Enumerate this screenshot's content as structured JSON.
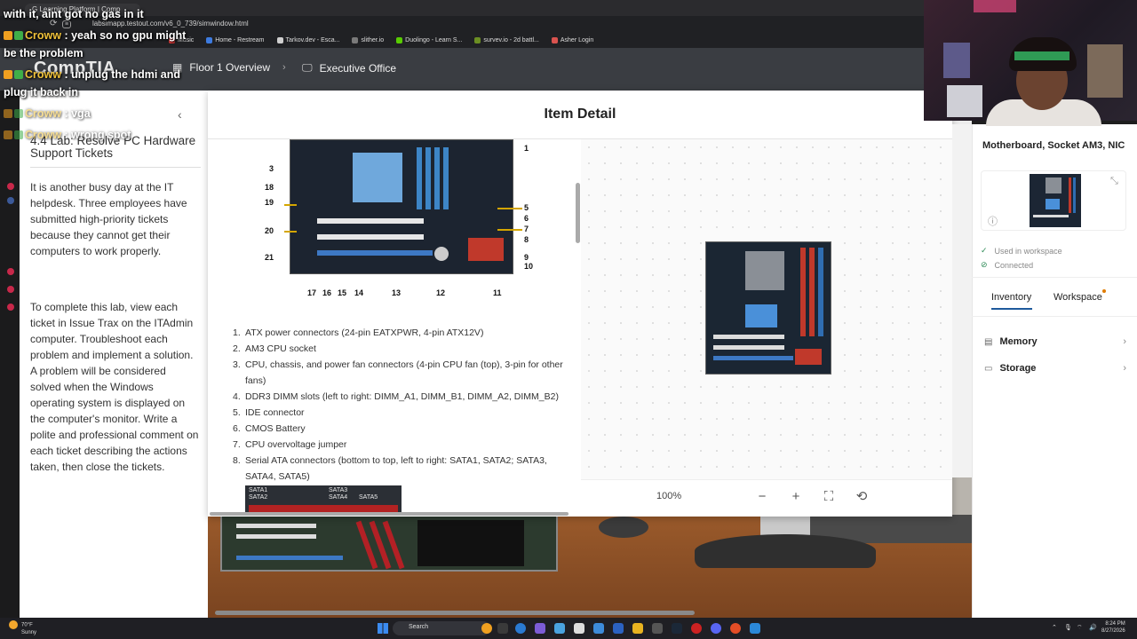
{
  "browser": {
    "tab_title": "G Learning Platform | Comp",
    "address": "labsimapp.testout.com/v6_0_739/simwindow.html",
    "bookmarks": [
      {
        "label": "Music",
        "color": "#e03a3a"
      },
      {
        "label": "Home - Restream",
        "color": "#3d7be0"
      },
      {
        "label": "Tarkov.dev - Esca...",
        "color": "#cfcfcf"
      },
      {
        "label": "slither.io",
        "color": "#7a7a7a"
      },
      {
        "label": "Duolingo - Learn S...",
        "color": "#58cc02"
      },
      {
        "label": "survev.io - 2d battl...",
        "color": "#6b8e23"
      },
      {
        "label": "Asher Login",
        "color": "#d9534f"
      }
    ]
  },
  "header": {
    "logo": "CompTIA",
    "crumbs": [
      {
        "label": "Floor 1 Overview",
        "icon": "floor-plan-icon"
      },
      {
        "label": "Executive Office",
        "icon": "monitor-icon"
      }
    ],
    "separator": "›"
  },
  "lab": {
    "title": "4.4 Lab: Resolve PC Hardware Support Tickets",
    "paragraph1": "It is another busy day at the IT helpdesk. Three employees have submitted high-priority tickets because they cannot get their computers to work properly.",
    "paragraph2": "To complete this lab, view each ticket in Issue Trax on the ITAdmin computer. Troubleshoot each problem and implement a solution. A problem will be considered solved when the Windows operating system is displayed on the computer's monitor. Write a polite and professional comment on each ticket describing the actions taken, then close the tickets.",
    "collapse_icon": "‹"
  },
  "modal": {
    "title": "Item Detail",
    "callouts": [
      "1",
      "3",
      "18",
      "19",
      "20",
      "21",
      "5",
      "6",
      "7",
      "8",
      "9",
      "10",
      "17",
      "16",
      "15",
      "14",
      "13",
      "12",
      "11"
    ],
    "components": [
      "ATX power connectors (24-pin EATXPWR, 4-pin ATX12V)",
      "AM3 CPU socket",
      "CPU, chassis, and power fan connectors (4-pin CPU fan (top), 3-pin for other fans)",
      "DDR3 DIMM slots (left to right: DIMM_A1, DIMM_B1, DIMM_A2, DIMM_B2)",
      "IDE connector",
      "CMOS Battery",
      "CPU overvoltage jumper",
      "Serial ATA connectors (bottom to top, left to right: SATA1, SATA2; SATA3, SATA4, SATA5)"
    ],
    "sata_labels": [
      "SATA1",
      "SATA2",
      "SATA3",
      "SATA4",
      "SATA5"
    ],
    "zoom": "100%",
    "controls": {
      "zoom_out": "−",
      "zoom_in": "+",
      "fit": "⛶",
      "rotate": "⟲"
    }
  },
  "sidebar": {
    "item_title": "Motherboard, Socket AM3, NIC",
    "info_icon": "ⓘ",
    "collapse_icon": "⤡",
    "status": [
      {
        "label": "Used in workspace",
        "icon": "✓"
      },
      {
        "label": "Connected",
        "icon": "⊘"
      }
    ],
    "tabs": [
      {
        "label": "Inventory",
        "active": true
      },
      {
        "label": "Workspace",
        "active": false
      }
    ],
    "items": [
      {
        "label": "Memory",
        "icon": "▤"
      },
      {
        "label": "Storage",
        "icon": "▭"
      }
    ],
    "chevron": "›"
  },
  "chat": [
    {
      "name": "",
      "text": "with it, aint got no gas in it",
      "faded": false
    },
    {
      "name": "Croww",
      "text": ": yeah so no gpu might",
      "faded": false
    },
    {
      "name": "",
      "text": "be the problem",
      "faded": false
    },
    {
      "name": "Croww",
      "text": ": unplug the hdmi and",
      "faded": false
    },
    {
      "name": "",
      "text": "plug it back in",
      "faded": false
    },
    {
      "name": "Croww",
      "text": ": vga",
      "faded": true
    },
    {
      "name": "Croww",
      "text": ": wrong spot",
      "faded": true
    }
  ],
  "taskbar": {
    "weather_temp": "70°F",
    "weather_desc": "Sunny",
    "search": "Search",
    "time": "8:24 PM",
    "date": "8/27/2026"
  },
  "colors": {
    "header_bg": "#3a3d42",
    "accent_blue": "#1e5a9c",
    "dot_orange": "#e07b00",
    "chat_name": "#f0c23a"
  }
}
